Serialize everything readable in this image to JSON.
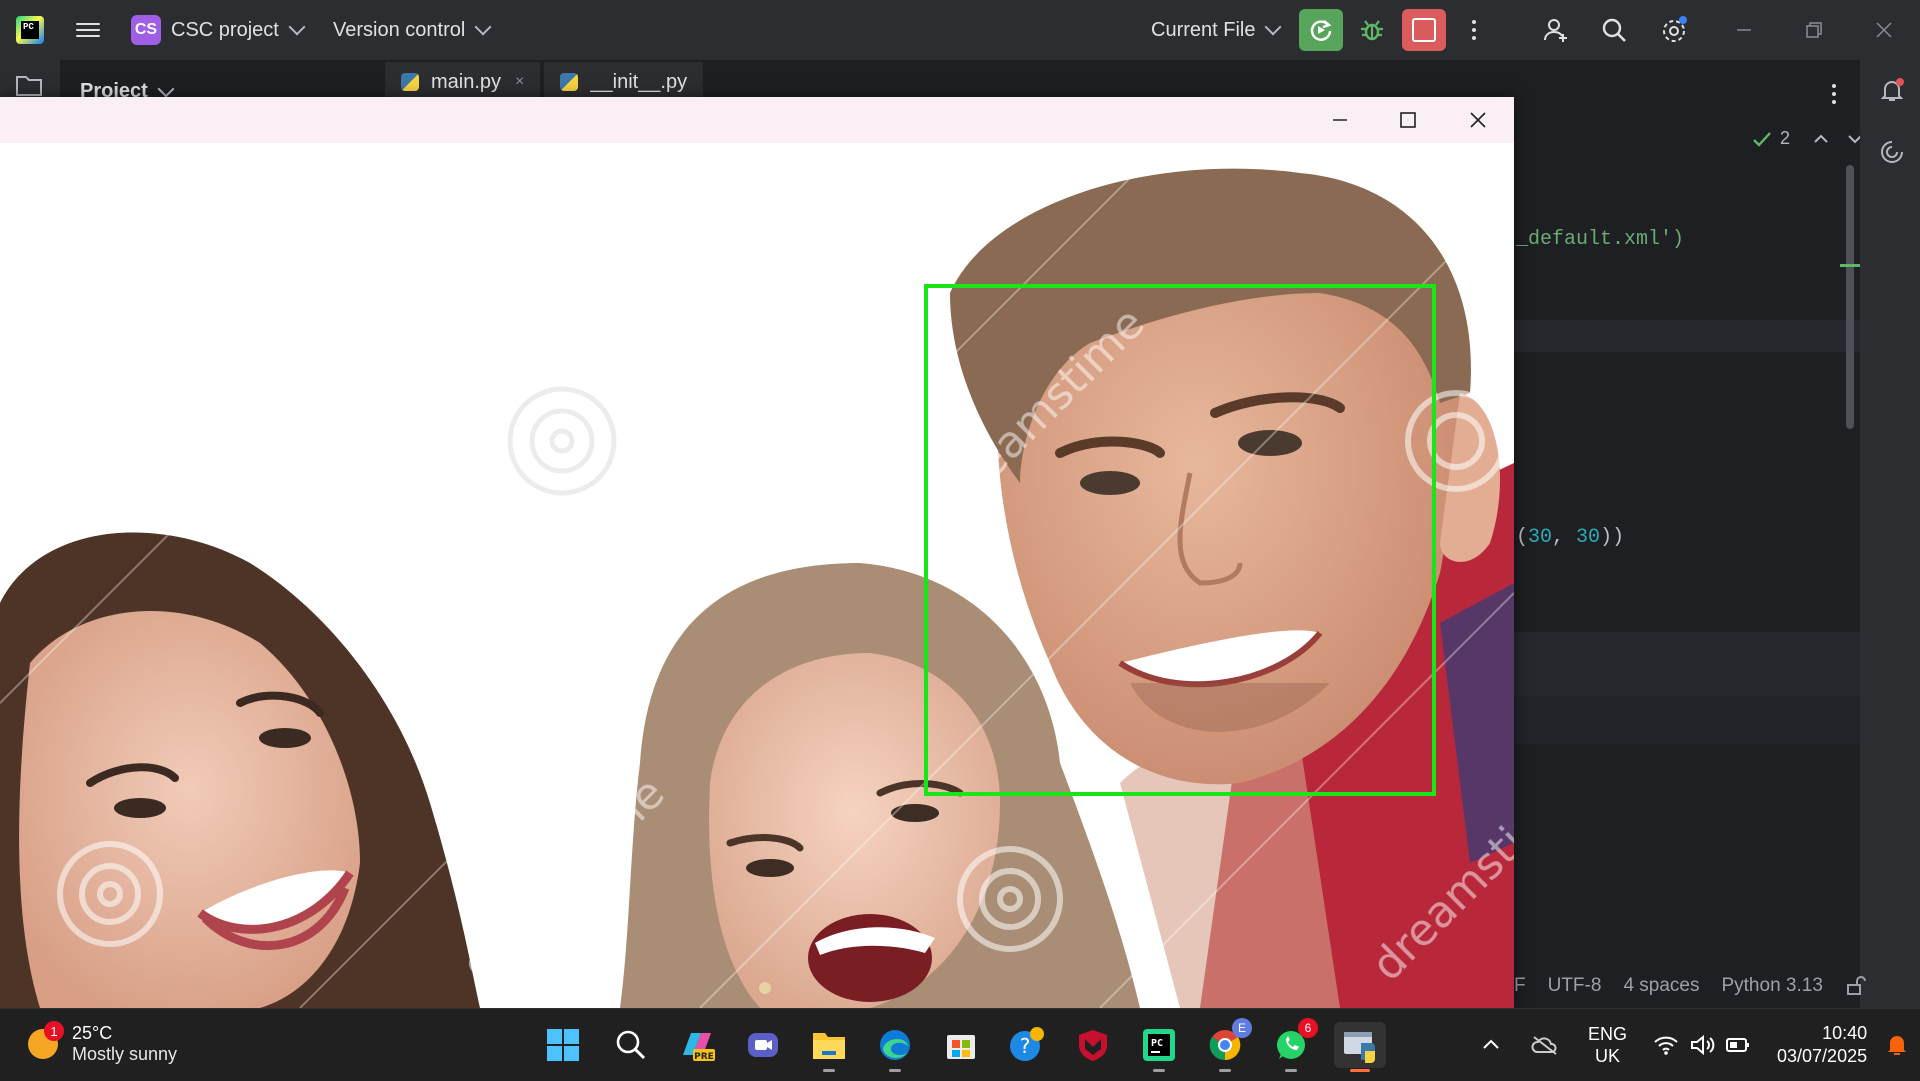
{
  "ide": {
    "project_badge": "CS",
    "project_name": "CSC project",
    "vcs_label": "Version control",
    "run_config": "Current File",
    "project_panel_title": "Project",
    "tabs": [
      {
        "label": "main.py",
        "close": "×"
      },
      {
        "label": "__init__.py"
      }
    ],
    "code_snippets": {
      "line_a": "_default.xml')",
      "line_b_open": "(",
      "line_b_n1": "30",
      "line_b_sep": ", ",
      "line_b_n2": "30",
      "line_b_close": "))"
    },
    "inspection_count": "2",
    "status": {
      "line_sep": "F",
      "encoding": "UTF-8",
      "indent": "4 spaces",
      "interpreter": "Python 3.13"
    },
    "colors": {
      "run_green": "#57a55a",
      "stop_red": "#db5c5c",
      "badge_purple": "#9f5ee6",
      "string_green": "#6aab73",
      "number_blue": "#2aacb8"
    }
  },
  "viewer": {
    "detection_box_color": "#19e619",
    "watermark": "dreamstime",
    "detections": 1
  },
  "taskbar": {
    "weather": {
      "temp": "25°C",
      "condition": "Mostly sunny",
      "badge": "1"
    },
    "apps": [
      {
        "name": "start"
      },
      {
        "name": "search"
      },
      {
        "name": "copilot-preview",
        "label": "PRE"
      },
      {
        "name": "teams-meet"
      },
      {
        "name": "file-explorer"
      },
      {
        "name": "edge"
      },
      {
        "name": "microsoft-store"
      },
      {
        "name": "help"
      },
      {
        "name": "mcafee"
      },
      {
        "name": "pycharm",
        "label": "PC"
      },
      {
        "name": "chrome",
        "badge": "E"
      },
      {
        "name": "whatsapp",
        "badge": "6"
      },
      {
        "name": "python-viewer"
      }
    ],
    "tray": {
      "lang_top": "ENG",
      "lang_bottom": "UK",
      "time": "10:40",
      "date": "03/07/2025"
    }
  }
}
